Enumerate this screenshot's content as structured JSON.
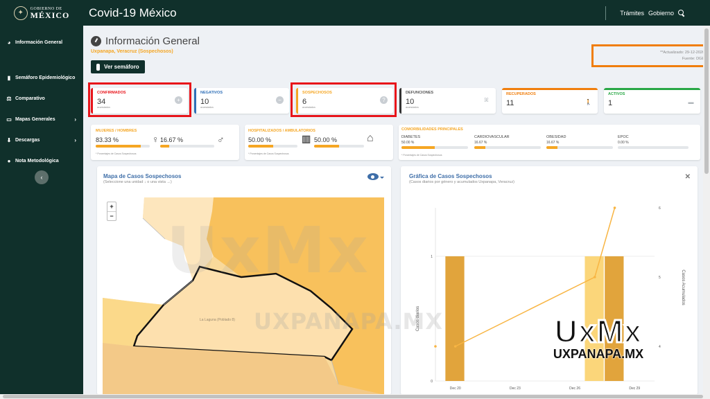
{
  "header": {
    "logo_line1": "GOBIERNO DE",
    "logo_line2": "MÉXICO",
    "title": "Covid-19 México",
    "links": [
      "Trámites",
      "Gobierno"
    ]
  },
  "sidebar": {
    "items": [
      {
        "label": "Información General",
        "icon": "dashboard-icon",
        "chevron": false
      },
      {
        "label": "Semáforo Epidemiológico",
        "icon": "traffic-light-icon",
        "chevron": false
      },
      {
        "label": "Comparativo",
        "icon": "compare-icon",
        "chevron": false
      },
      {
        "label": "Mapas Generales",
        "icon": "map-icon",
        "chevron": true
      },
      {
        "label": "Descargas",
        "icon": "download-icon",
        "chevron": true
      },
      {
        "label": "Nota Metodológica",
        "icon": "info-icon",
        "chevron": false
      }
    ]
  },
  "page": {
    "title": "Información General",
    "subtitle": "Uxpanapa, Veracruz (Sospechosos)",
    "semaforo_button": "Ver semáforo",
    "updated": "**Actualizado: 29-12-2020",
    "source": "Fuente: DGE"
  },
  "stats": [
    {
      "label": "CONFIRMADOS",
      "value": "34",
      "sub": "acumulados",
      "color": "#e8141a",
      "icon": "plus-circle-icon"
    },
    {
      "label": "NEGATIVOS",
      "value": "10",
      "sub": "acumulados",
      "color": "#2f6fb7",
      "icon": "minus-circle-icon"
    },
    {
      "label": "SOSPECHOSOS",
      "value": "6",
      "sub": "acumulados",
      "color": "#f5a623",
      "icon": "question-circle-icon"
    },
    {
      "label": "DEFUNCIONES",
      "value": "10",
      "sub": "acumulados",
      "color": "#333333",
      "icon": "ribbon-icon"
    },
    {
      "label": "RECUPERADOS",
      "value": "11",
      "sub": "",
      "color": "#f07e0c",
      "icon": "walking-icon"
    },
    {
      "label": "ACTIVOS",
      "value": "1",
      "sub": "",
      "color": "#28a745",
      "icon": "bed-icon"
    }
  ],
  "gender": {
    "title": "MUJERES / HOMBRES",
    "women": "83.33 %",
    "women_pct": 83.33,
    "men": "16.67 %",
    "men_pct": 16.67,
    "footnote": "* Porcentajes de Casos Sospechosos"
  },
  "hospital": {
    "title": "HOSPITALIZADOS / AMBULATORIOS",
    "hosp": "50.00 %",
    "hosp_pct": 50,
    "amb": "50.00 %",
    "amb_pct": 50,
    "footnote": "* Porcentajes de Casos Sospechosos"
  },
  "comorbid": {
    "title": "COMORBILIDADES PRINCIPALES",
    "items": [
      {
        "label": "DIABETES",
        "value": "50.00 %",
        "pct": 50
      },
      {
        "label": "CARDIOVASCULAR",
        "value": "16.67 %",
        "pct": 16.67
      },
      {
        "label": "OBESIDAD",
        "value": "16.67 %",
        "pct": 16.67
      },
      {
        "label": "EPOC",
        "value": "0.00 %",
        "pct": 0
      }
    ],
    "footnote": "* Porcentajes de Casos Sospechosos"
  },
  "map": {
    "title": "Mapa de Casos Sospechosos",
    "subtitle": "(Seleccione una unidad ↓ o una vista →)",
    "zoom_in": "+",
    "zoom_out": "−",
    "place_label": "La Laguna (Poblado 8)"
  },
  "chart_card": {
    "title": "Gráfica de Casos Sospechosos",
    "subtitle": "(Casos diarios por género y acumulados Uxpanapa, Veracruz)"
  },
  "chart_data": {
    "type": "bar",
    "x_labels": [
      "Dec 20",
      "Dec 23",
      "Dec 26",
      "Dec 29"
    ],
    "ylabel": "Casos diarios",
    "y2label": "Casos Acumulados",
    "y_ticks": [
      "0",
      "1"
    ],
    "y2_ticks": [
      "4",
      "5",
      "6"
    ],
    "ylim": [
      0,
      1
    ],
    "y2lim": [
      3.5,
      6
    ],
    "bars": [
      {
        "day": 0,
        "value": 1,
        "color": "#e1a43c"
      },
      {
        "day": 7,
        "value": 1,
        "color": "#fbd67a"
      },
      {
        "day": 8,
        "value": 1,
        "color": "#e1a43c"
      }
    ],
    "bar_days_span": 1,
    "days_range": [
      -1,
      10
    ],
    "cumulative": [
      {
        "day": -1,
        "value": 4
      },
      {
        "day": 0,
        "value": 4
      },
      {
        "day": 7,
        "value": 5
      },
      {
        "day": 8,
        "value": 6
      }
    ],
    "tick_days": [
      0,
      3,
      6,
      9
    ]
  },
  "watermark": {
    "big": "UxMx",
    "mid": "UXPANAPA.MX",
    "logo_big": "UxMx",
    "logo_small": "UXPANAPA.MX"
  }
}
